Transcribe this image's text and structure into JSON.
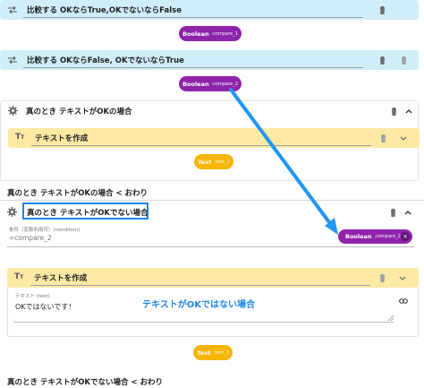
{
  "block1": {
    "label": "比較する OKならTrue,OKでないならFalse",
    "pill_type": "Boolean",
    "pill_name": ":compare_1"
  },
  "block2": {
    "label": "比較する OKならFalse, OKでないならTrue",
    "pill_type": "Boolean",
    "pill_name": ":compare_2"
  },
  "if1": {
    "label": "真のとき テキストがOKの場合"
  },
  "text1": {
    "label": "テキストを作成",
    "pill_type": "Text",
    "pill_name": ":text_2"
  },
  "if1_end": "真のとき テキストがOKの場合 < おわり",
  "if2": {
    "label": "真のとき テキストがOKでない場合",
    "condition_label": "条件（変数利用可）(condition)",
    "condition_value": "=compare_2",
    "pill_type": "Boolean",
    "pill_name": ":compare_2"
  },
  "text2": {
    "label": "テキストを作成",
    "field_label": "テキスト (text)",
    "field_value": "OKではないです！",
    "annotation": "テキストがOKではない場合",
    "pill_type": "Text",
    "pill_name": ":text_3"
  },
  "if2_end": "真のとき テキストがOKでない場合 < おわり",
  "colors": {
    "compare_block": "#cfeefa",
    "text_block": "#fde9a4",
    "boolean_pill": "#8e24aa",
    "text_pill": "#f6b500",
    "arrow": "#2196f3",
    "highlight_border": "#1e88e5"
  },
  "icons": [
    "arrow-exchange-icon",
    "gear-icon",
    "text-format-icon",
    "trash-icon",
    "chevron-up-icon",
    "chevron-down-icon",
    "link-icon",
    "close-icon"
  ]
}
